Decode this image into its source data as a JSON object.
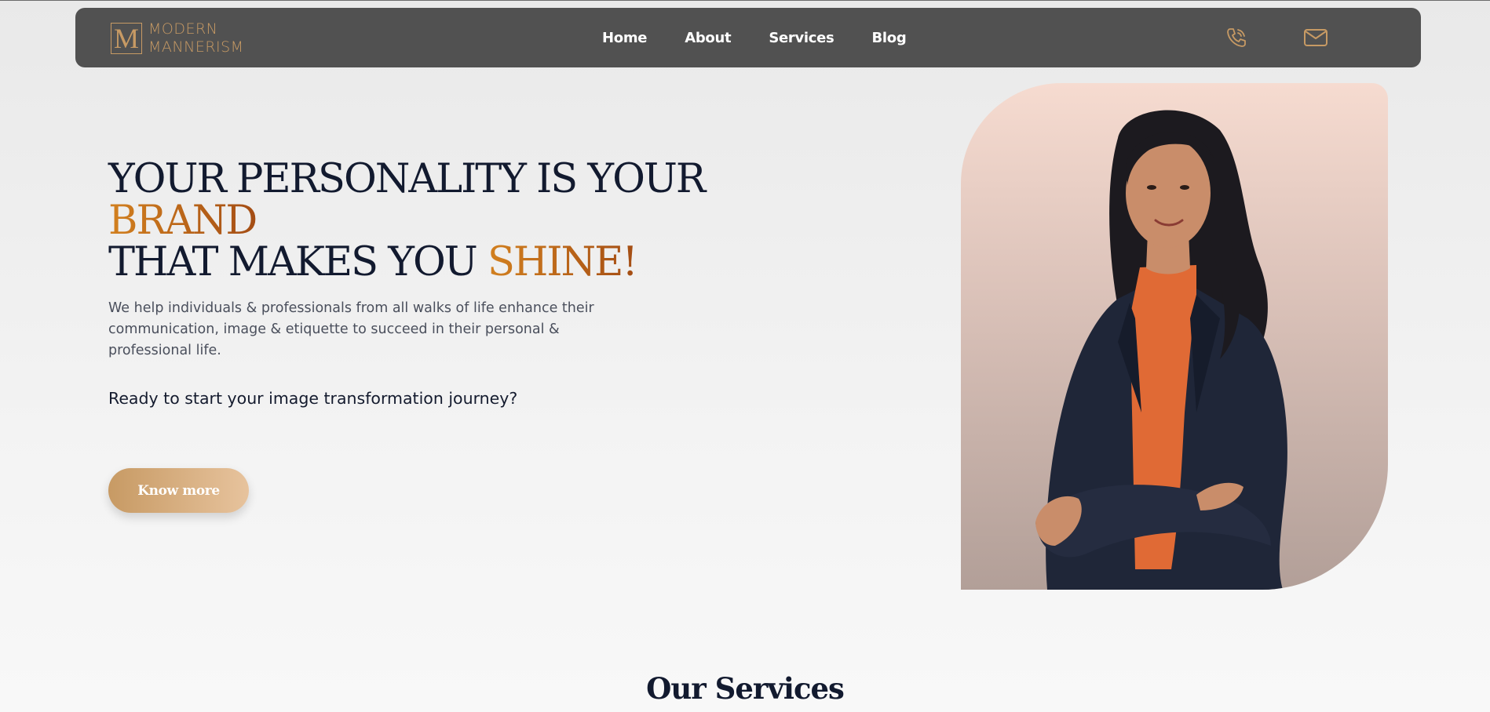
{
  "logo": {
    "line1": "MODERN",
    "line2": "MANNERISM",
    "mark": "M"
  },
  "nav": {
    "links": [
      "Home",
      "About",
      "Services",
      "Blog"
    ],
    "icons": [
      "phone-icon",
      "mail-icon"
    ]
  },
  "hero": {
    "headline_part1": "YOUR PERSONALITY IS YOUR ",
    "headline_accent1": "BRAND",
    "headline_part2": "THAT MAKES YOU ",
    "headline_accent2": "SHINE!",
    "lead": "We help individuals & professionals from all walks of life enhance their communication, image & etiquette to succeed in their personal & professional life.",
    "cta_text": "Ready to start your image transformation journey?",
    "button": "Know more"
  },
  "services": {
    "title": "Our Services"
  },
  "colors": {
    "nav_bg": "#515151",
    "accent_gold": "#c79a64",
    "accent_orange": "#d2801f",
    "heading": "#121a2f"
  }
}
